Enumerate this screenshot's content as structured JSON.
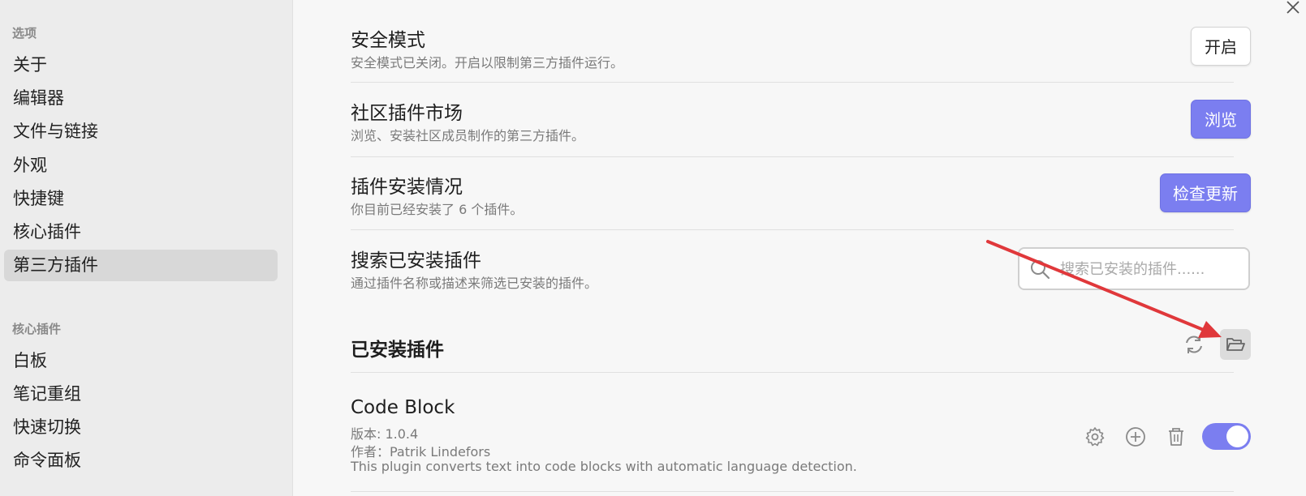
{
  "sidebar": {
    "options_title": "选项",
    "options_items": [
      "关于",
      "编辑器",
      "文件与链接",
      "外观",
      "快捷键",
      "核心插件",
      "第三方插件"
    ],
    "core_title": "核心插件",
    "core_items": [
      "白板",
      "笔记重组",
      "快速切换",
      "命令面板"
    ]
  },
  "settings": {
    "safe_mode": {
      "title": "安全模式",
      "desc": "安全模式已关闭。开启以限制第三方插件运行。",
      "button": "开启"
    },
    "community": {
      "title": "社区插件市场",
      "desc": "浏览、安装社区成员制作的第三方插件。",
      "button": "浏览"
    },
    "install_status": {
      "title": "插件安装情况",
      "desc": "你目前已经安装了 6 个插件。",
      "button": "检查更新"
    },
    "search": {
      "title": "搜索已安装插件",
      "desc": "通过插件名称或描述来筛选已安装的插件。",
      "placeholder": "搜索已安装的插件......"
    }
  },
  "installed": {
    "heading": "已安装插件",
    "plugins": [
      {
        "name": "Code Block",
        "version": "版本: 1.0.4",
        "author": "作者：Patrik Lindefors",
        "description": "This plugin converts text into code blocks with automatic language detection.",
        "enabled": true
      }
    ]
  },
  "colors": {
    "accent": "#7b7ef0",
    "annotation_arrow": "#e0383b"
  },
  "icons": [
    "close-icon",
    "search-icon",
    "reload-icon",
    "folder-open-icon",
    "gear-icon",
    "plus-circle-icon",
    "trash-icon"
  ]
}
